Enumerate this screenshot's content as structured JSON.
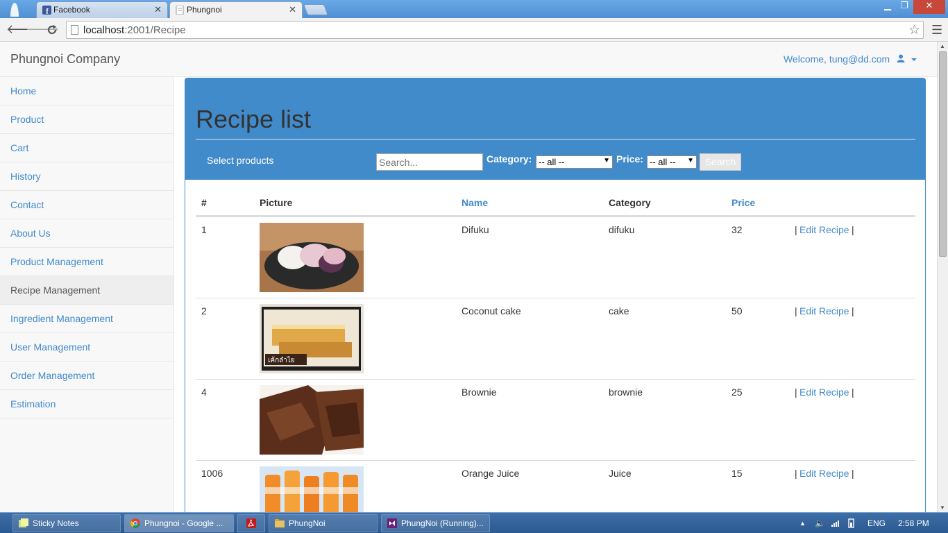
{
  "browser": {
    "tabs": [
      {
        "label": "Facebook",
        "close": "✕"
      },
      {
        "label": "Phungnoi",
        "close": "✕"
      }
    ],
    "url_host": "localhost",
    "url_path": ":2001/Recipe",
    "window_controls": {
      "min": "▁",
      "max": "❐",
      "close": "✕"
    }
  },
  "site": {
    "brand": "Phungnoi Company",
    "welcome": "Welcome, tung@dd.com"
  },
  "sidebar": {
    "items": [
      {
        "label": "Home"
      },
      {
        "label": "Product"
      },
      {
        "label": "Cart"
      },
      {
        "label": "History"
      },
      {
        "label": "Contact"
      },
      {
        "label": "About Us"
      },
      {
        "label": "Product Management"
      },
      {
        "label": "Recipe Management"
      },
      {
        "label": "Ingredient Management"
      },
      {
        "label": "User Management"
      },
      {
        "label": "Order Management"
      },
      {
        "label": "Estimation"
      }
    ],
    "active": "Recipe Management"
  },
  "page": {
    "title": "Recipe list",
    "select_label": "Select products",
    "search_placeholder": "Search...",
    "category_label": "Category:",
    "category_value": "-- all --",
    "price_label": "Price:",
    "price_value": "-- all --",
    "search_button": "Search"
  },
  "table": {
    "headers": {
      "num": "#",
      "picture": "Picture",
      "name": "Name",
      "category": "Category",
      "price": "Price"
    },
    "rows": [
      {
        "id": "1",
        "name": "Difuku",
        "category": "difuku",
        "price": "32",
        "action_pre": "|",
        "action": "Edit Recipe",
        "action_post": "|"
      },
      {
        "id": "2",
        "name": "Coconut cake",
        "category": "cake",
        "price": "50",
        "action_pre": "|",
        "action": "Edit Recipe",
        "action_post": "|"
      },
      {
        "id": "4",
        "name": "Brownie",
        "category": "brownie",
        "price": "25",
        "action_pre": "|",
        "action": "Edit Recipe",
        "action_post": "|"
      },
      {
        "id": "1006",
        "name": "Orange Juice",
        "category": "Juice",
        "price": "15",
        "action_pre": "|",
        "action": "Edit Recipe",
        "action_post": "|"
      }
    ]
  },
  "taskbar": {
    "items": [
      {
        "label": "Sticky Notes"
      },
      {
        "label": "Phungnoi - Google ..."
      },
      {
        "label": ""
      },
      {
        "label": "PhungNoi"
      },
      {
        "label": "PhungNoi (Running)..."
      }
    ],
    "language": "ENG",
    "time": "2:58 PM"
  },
  "colors": {
    "accent": "#428bca",
    "taskbar": "#2b5a92"
  }
}
